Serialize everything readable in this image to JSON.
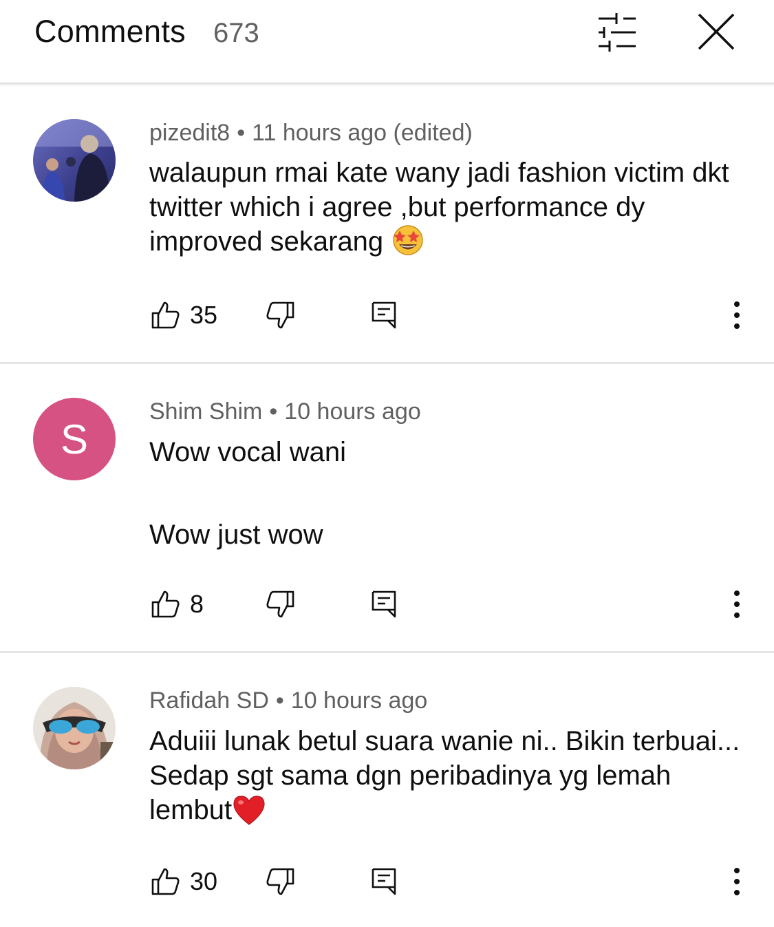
{
  "header": {
    "title": "Comments",
    "count": "673",
    "filter_icon": "sliders-icon",
    "close_icon": "close-icon"
  },
  "comments": [
    {
      "author": "pizedit8",
      "separator": "•",
      "time": "11 hours ago (edited)",
      "text": "walaupun rmai kate wany jadi fashion victim dkt twitter which i agree ,but performance dy improved sekarang",
      "emoji": "star-struck-emoji",
      "likes": "35",
      "avatar": "photo-avatar"
    },
    {
      "author": "Shim Shim",
      "separator": "•",
      "time": "10 hours ago",
      "text_line1": "Wow vocal wani",
      "text_line2": "Wow just wow",
      "likes": "8",
      "avatar_letter": "S",
      "avatar_color": "#d65282"
    },
    {
      "author": "Rafidah SD",
      "separator": "•",
      "time": "10 hours ago",
      "text": "Aduiii lunak betul suara wanie ni.. Bikin terbuai... Sedap sgt sama dgn peribadinya yg lemah lembut",
      "emoji": "red-heart-emoji",
      "likes": "30",
      "avatar": "photo-avatar"
    }
  ]
}
